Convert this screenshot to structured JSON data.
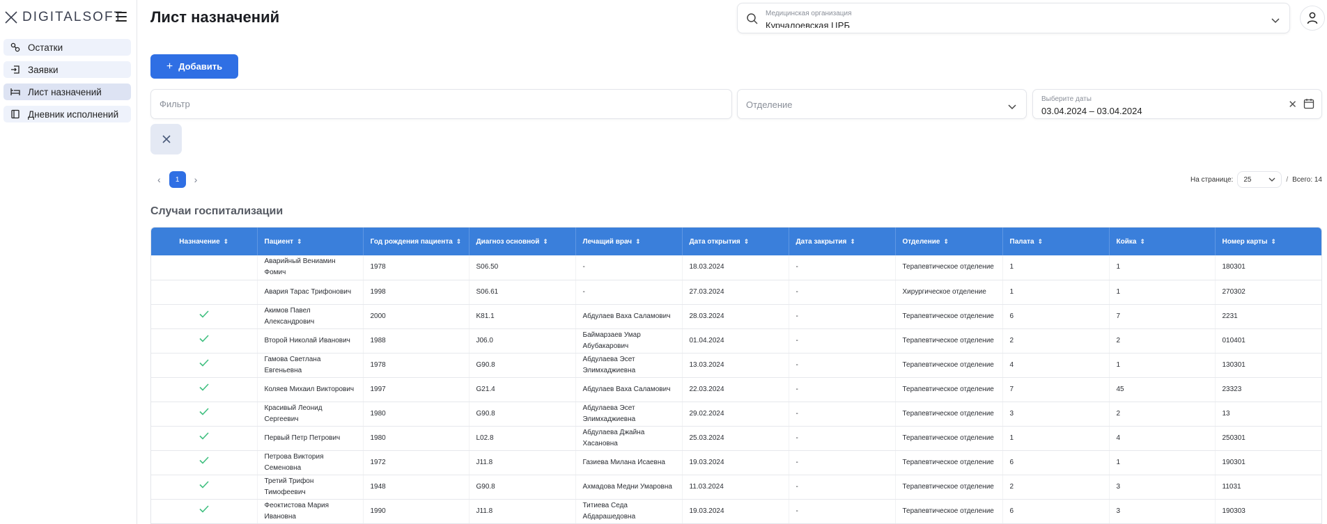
{
  "logo": {
    "text": "DIGITALSOFT"
  },
  "sidebar": {
    "items": [
      {
        "label": "Остатки",
        "icon": "remains-icon"
      },
      {
        "label": "Заявки",
        "icon": "requests-icon"
      },
      {
        "label": "Лист назначений",
        "icon": "bed-icon",
        "active": true
      },
      {
        "label": "Дневник исполнений",
        "icon": "journal-icon"
      }
    ]
  },
  "header": {
    "title": "Лист назначений",
    "org_label": "Медицинская организация",
    "org_value": "Курчалоевская ЦРБ"
  },
  "toolbar": {
    "add_label": "Добавить"
  },
  "filters": {
    "filter_placeholder": "Фильтр",
    "dept_placeholder": "Отделение",
    "date_label": "Выберите даты",
    "date_value": "03.04.2024 – 03.04.2024"
  },
  "pagination": {
    "prev": "‹",
    "next": "›",
    "current_page": "1",
    "per_page_label": "На странице:",
    "per_page_value": "25",
    "total_label": "Всего: 14"
  },
  "section": {
    "title": "Случаи госпитализации"
  },
  "table": {
    "columns": [
      "Назначение",
      "Пациент",
      "Год рождения пациента",
      "Диагноз основной",
      "Лечащий врач",
      "Дата открытия",
      "Дата закрытия",
      "Отделение",
      "Палата",
      "Койка",
      "Номер карты"
    ],
    "rows": [
      {
        "check": false,
        "patient": "Аварийный Вениамин Фомич",
        "year": "1978",
        "diag": "S06.50",
        "doctor": "-",
        "open": "18.03.2024",
        "close": "-",
        "dept": "Терапевтическое отделение",
        "ward": "1",
        "bed": "1",
        "card": "180301"
      },
      {
        "check": false,
        "patient": "Авария Тарас Трифонович",
        "year": "1998",
        "diag": "S06.61",
        "doctor": "-",
        "open": "27.03.2024",
        "close": "-",
        "dept": "Хирургическое отделение",
        "ward": "1",
        "bed": "1",
        "card": "270302"
      },
      {
        "check": true,
        "patient": "Акимов Павел Александрович",
        "year": "2000",
        "diag": "K81.1",
        "doctor": "Абдулаев Ваха Саламович",
        "open": "28.03.2024",
        "close": "-",
        "dept": "Терапевтическое отделение",
        "ward": "6",
        "bed": "7",
        "card": "2231"
      },
      {
        "check": true,
        "patient": "Второй Николай Иванович",
        "year": "1988",
        "diag": "J06.0",
        "doctor": "Баймарзаев Умар Абубакарович",
        "open": "01.04.2024",
        "close": "-",
        "dept": "Терапевтическое отделение",
        "ward": "2",
        "bed": "2",
        "card": "010401"
      },
      {
        "check": true,
        "patient": "Гамова Светлана Евгеньевна",
        "year": "1978",
        "diag": "G90.8",
        "doctor": "Абдулаева Эсет Элимхаджиевна",
        "open": "13.03.2024",
        "close": "-",
        "dept": "Терапевтическое отделение",
        "ward": "4",
        "bed": "1",
        "card": "130301"
      },
      {
        "check": true,
        "patient": "Коляев Михаил Викторович",
        "year": "1997",
        "diag": "G21.4",
        "doctor": "Абдулаев Ваха Саламович",
        "open": "22.03.2024",
        "close": "-",
        "dept": "Терапевтическое отделение",
        "ward": "7",
        "bed": "45",
        "card": "23323"
      },
      {
        "check": true,
        "patient": "Красивый Леонид Сергеевич",
        "year": "1980",
        "diag": "G90.8",
        "doctor": "Абдулаева Эсет Элимхаджиевна",
        "open": "29.02.2024",
        "close": "-",
        "dept": "Терапевтическое отделение",
        "ward": "3",
        "bed": "2",
        "card": "13"
      },
      {
        "check": true,
        "patient": "Первый Петр Петрович",
        "year": "1980",
        "diag": "L02.8",
        "doctor": "Абдулаева Джайна Хасановна",
        "open": "25.03.2024",
        "close": "-",
        "dept": "Терапевтическое отделение",
        "ward": "1",
        "bed": "4",
        "card": "250301"
      },
      {
        "check": true,
        "patient": "Петрова Виктория Семеновна",
        "year": "1972",
        "diag": "J11.8",
        "doctor": "Газиева Милана Исаевна",
        "open": "19.03.2024",
        "close": "-",
        "dept": "Терапевтическое отделение",
        "ward": "6",
        "bed": "1",
        "card": "190301"
      },
      {
        "check": true,
        "patient": "Третий Трифон Тимофеевич",
        "year": "1948",
        "diag": "G90.8",
        "doctor": "Ахмадова Медни Умаровна",
        "open": "11.03.2024",
        "close": "-",
        "dept": "Терапевтическое отделение",
        "ward": "2",
        "bed": "3",
        "card": "11031"
      },
      {
        "check": true,
        "patient": "Феоктистова Мария Ивановна",
        "year": "1990",
        "diag": "J11.8",
        "doctor": "Титиева Седа Абдарашедовна",
        "open": "19.03.2024",
        "close": "-",
        "dept": "Терапевтическое отделение",
        "ward": "6",
        "bed": "3",
        "card": "190303"
      }
    ]
  },
  "colors": {
    "primary": "#2f6fe4",
    "header": "#3a7fdb",
    "check": "#3fbf7f"
  }
}
